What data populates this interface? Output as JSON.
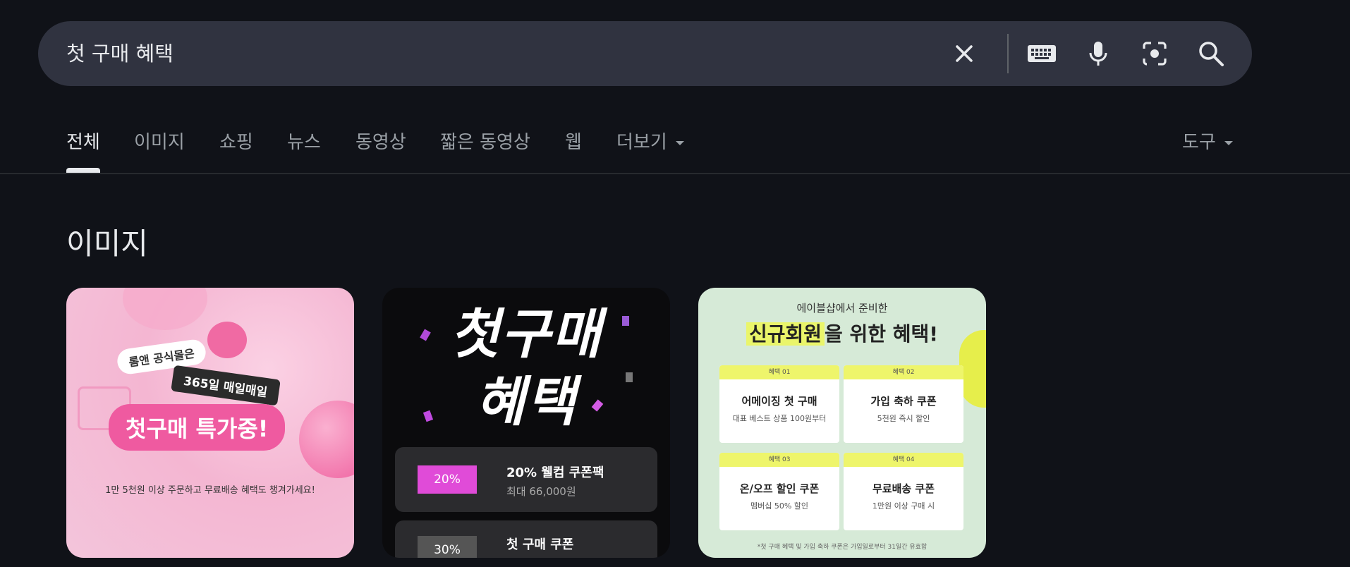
{
  "search": {
    "query": "첫 구매 혜택",
    "icons": [
      "close-icon",
      "keyboard-icon",
      "mic-icon",
      "lens-icon",
      "search-icon"
    ]
  },
  "tabs": [
    {
      "label": "전체",
      "active": true
    },
    {
      "label": "이미지"
    },
    {
      "label": "쇼핑"
    },
    {
      "label": "뉴스"
    },
    {
      "label": "동영상"
    },
    {
      "label": "짧은 동영상"
    },
    {
      "label": "웹"
    },
    {
      "label": "더보기"
    }
  ],
  "tools_label": "도구",
  "section_title": "이미지",
  "images": [
    {
      "lines": [
        "롬앤 공식몰은",
        "365일 매일매일",
        "첫구매 특가중!",
        "1만 5천원 이상 주문하고 무료배송 혜택도 챙겨가세요!"
      ]
    },
    {
      "headline": [
        "첫구매",
        "혜택"
      ],
      "card1": {
        "tag": "20%",
        "title": "20% 웰컴 쿠폰팩",
        "sub": "최대 66,000원"
      },
      "card2": {
        "tag": "30%",
        "title": "첫 구매 쿠폰"
      }
    },
    {
      "top1": "에이블샵에서 준비한",
      "top2_highlight": "신규회원",
      "top2_rest": "을 위한 혜택!",
      "boxes": [
        {
          "head": "혜택 01",
          "title": "어메이징 첫 구매",
          "sub": "대표 베스트 상품 100원부터"
        },
        {
          "head": "혜택 02",
          "title": "가입 축하 쿠폰",
          "sub": "5천원 즉시 할인"
        },
        {
          "head": "혜택 03",
          "title": "온/오프 할인 쿠폰",
          "sub": "멤버십 50% 할인"
        },
        {
          "head": "혜택 04",
          "title": "무료배송 쿠폰",
          "sub": "1만원 이상 구매 시"
        }
      ],
      "footer": "*첫 구매 혜택 및 가입 축하 쿠폰은 가입일로부터 31일간 유효함"
    }
  ]
}
